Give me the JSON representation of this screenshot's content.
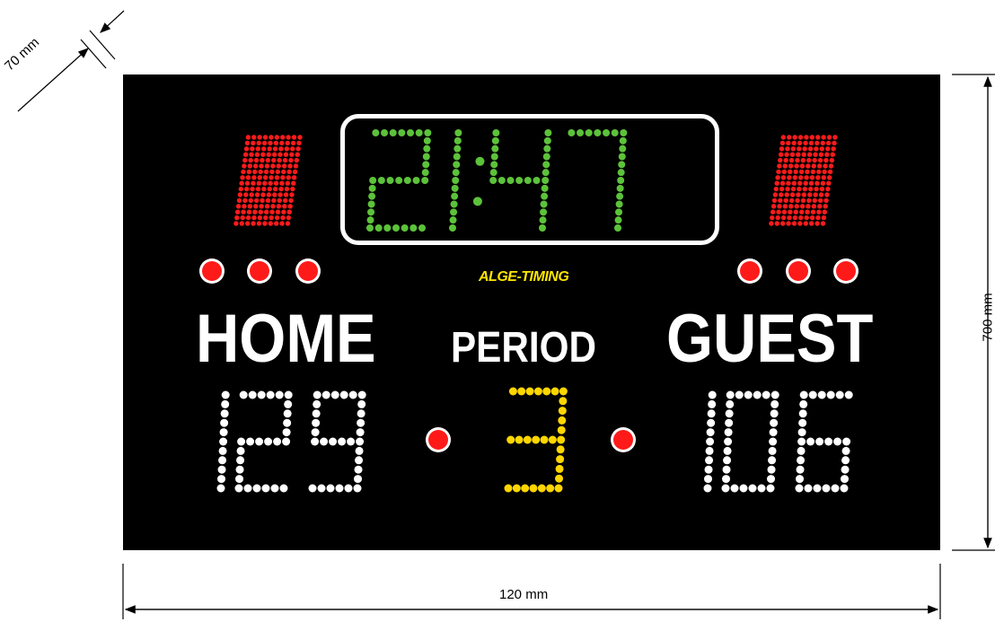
{
  "scoreboard": {
    "clock": "21:47",
    "home_label": "HOME",
    "guest_label": "GUEST",
    "period_label": "PERIOD",
    "home_score": "129",
    "guest_score": "106",
    "period": "3",
    "brand": "ALGE-TIMING",
    "home_fouls_lit": 3,
    "guest_fouls_lit": 3
  },
  "dimensions": {
    "width": "120 mm",
    "height": "700 mm",
    "depth": "70 mm"
  },
  "colors": {
    "board": "#000000",
    "clock_digits": "#5cc23a",
    "score_digits": "#ffffff",
    "period_digit": "#ffd600",
    "indicator_red": "#ff1a1a"
  }
}
